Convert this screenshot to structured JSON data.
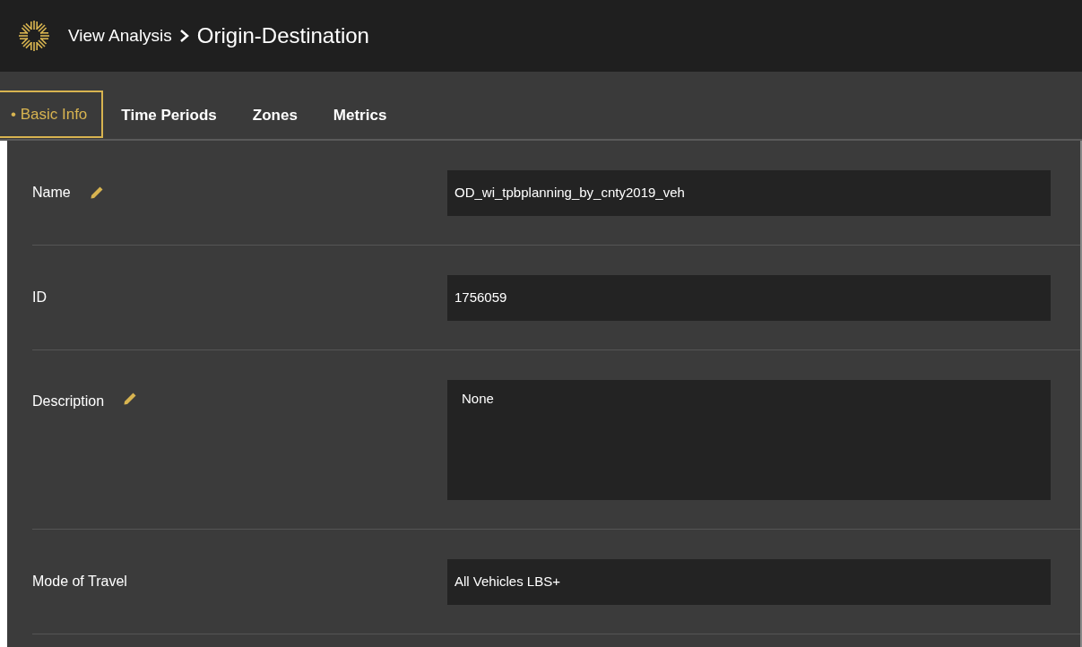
{
  "header": {
    "breadcrumb": "View Analysis",
    "title": "Origin-Destination"
  },
  "tabs": [
    {
      "label": "• Basic Info",
      "selected": true
    },
    {
      "label": "Time Periods",
      "selected": false
    },
    {
      "label": "Zones",
      "selected": false
    },
    {
      "label": "Metrics",
      "selected": false
    }
  ],
  "fields": [
    {
      "label": "Name",
      "editable": true,
      "kind": "line",
      "value": "OD_wi_tpbplanning_by_cnty2019_veh"
    },
    {
      "label": "ID",
      "editable": false,
      "kind": "line",
      "value": "1756059"
    },
    {
      "label": "Description",
      "editable": true,
      "kind": "multiline",
      "value": "None"
    },
    {
      "label": "Mode of Travel",
      "editable": false,
      "kind": "line",
      "value": "All Vehicles LBS+"
    }
  ]
}
